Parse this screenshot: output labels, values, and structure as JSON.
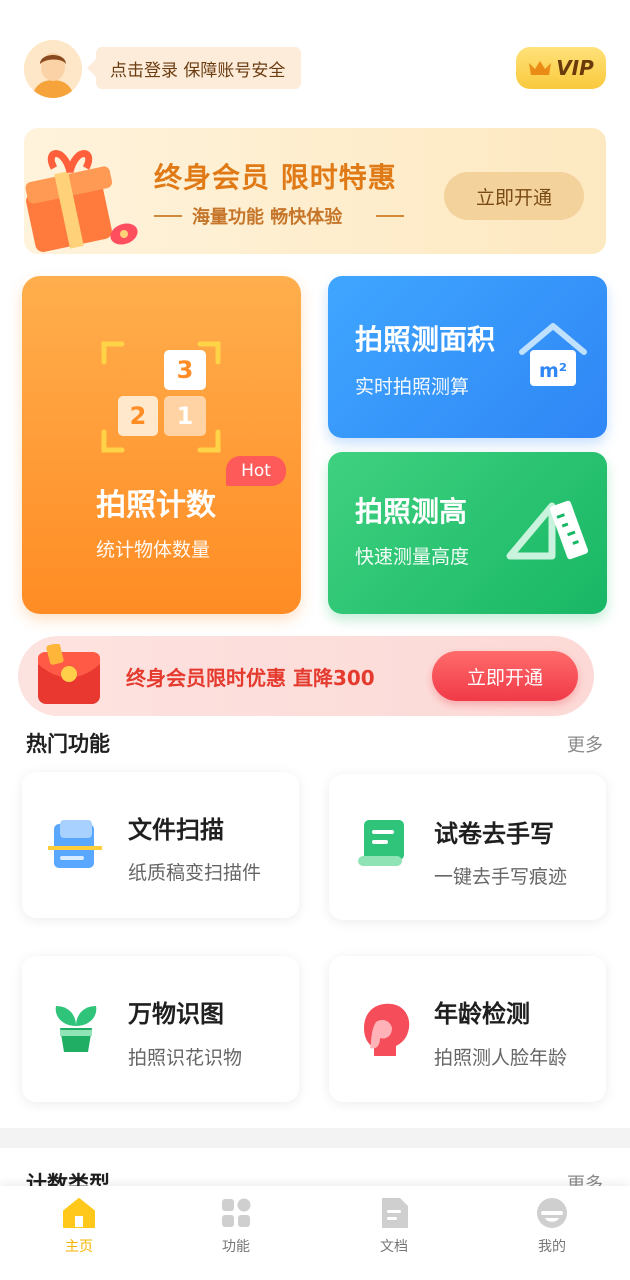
{
  "header": {
    "login_tip": "点击登录 保障账号安全",
    "vip_label": "VIP"
  },
  "member_banner": {
    "title": "终身会员 限时特惠",
    "subtitle": "海量功能 畅快体验",
    "button": "立即开通"
  },
  "features": [
    {
      "title": "拍照计数",
      "subtitle": "统计物体数量",
      "badge": "Hot",
      "icon": "counting-icon",
      "tiles": [
        "3",
        "2",
        "1"
      ]
    },
    {
      "title": "拍照测面积",
      "subtitle": "实时拍照测算",
      "icon": "area-house-icon",
      "unit": "m²"
    },
    {
      "title": "拍照测高",
      "subtitle": "快速测量高度",
      "icon": "ruler-triangle-icon"
    }
  ],
  "promo": {
    "text": "终身会员限时优惠 直降300",
    "button": "立即开通"
  },
  "hot_section": {
    "title": "热门功能",
    "more": "更多",
    "items": [
      {
        "title": "文件扫描",
        "subtitle": "纸质稿变扫描件",
        "icon": "document-scan-icon"
      },
      {
        "title": "试卷去手写",
        "subtitle": "一键去手写痕迹",
        "icon": "exam-paper-icon"
      },
      {
        "title": "万物识图",
        "subtitle": "拍照识花识物",
        "icon": "plant-icon"
      },
      {
        "title": "年龄检测",
        "subtitle": "拍照测人脸年龄",
        "icon": "face-profile-icon"
      }
    ]
  },
  "next_section": {
    "title": "计数类型",
    "more": "更多"
  },
  "tabbar": {
    "items": [
      {
        "label": "主页",
        "icon": "home-icon",
        "active": true
      },
      {
        "label": "功能",
        "icon": "grid-icon",
        "active": false
      },
      {
        "label": "文档",
        "icon": "document-icon",
        "active": false
      },
      {
        "label": "我的",
        "icon": "profile-icon",
        "active": false
      }
    ]
  },
  "colors": {
    "accent_orange": "#ff8c24",
    "accent_blue": "#2f86f5",
    "accent_green": "#18b765",
    "promo_red": "#f03a48",
    "tab_active": "#f5b400"
  }
}
